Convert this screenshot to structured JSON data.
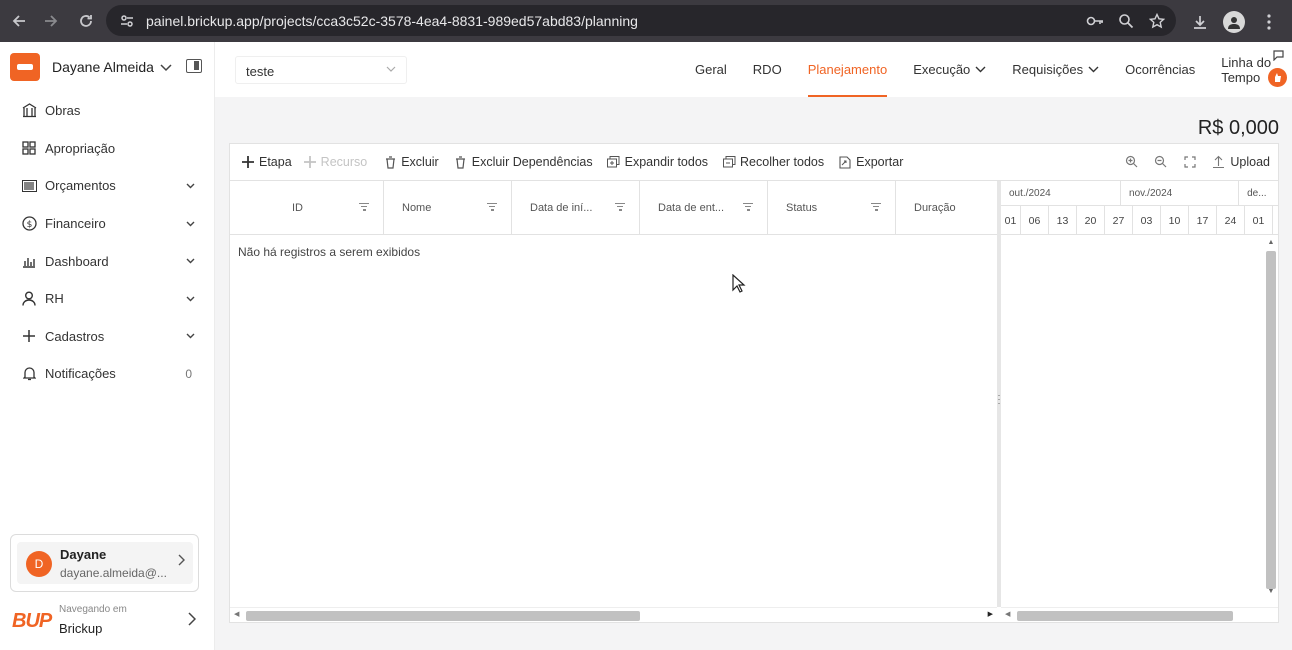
{
  "browser": {
    "url": "painel.brickup.app/projects/cca3c52c-3578-4ea4-8831-989ed57abd83/planning"
  },
  "sidebar": {
    "user_name": "Dayane Almeida",
    "items": [
      {
        "label": "Obras",
        "icon": "building-icon",
        "has_chevron": false
      },
      {
        "label": "Apropriação",
        "icon": "grid-icon",
        "has_chevron": false
      },
      {
        "label": "Orçamentos",
        "icon": "barcode-icon",
        "has_chevron": true
      },
      {
        "label": "Financeiro",
        "icon": "dollar-circle-icon",
        "has_chevron": true
      },
      {
        "label": "Dashboard",
        "icon": "bar-chart-icon",
        "has_chevron": true
      },
      {
        "label": "RH",
        "icon": "person-icon",
        "has_chevron": true
      },
      {
        "label": "Cadastros",
        "icon": "plus-icon",
        "has_chevron": true
      },
      {
        "label": "Notificações",
        "icon": "bell-icon",
        "count": "0"
      }
    ],
    "user_card": {
      "initial": "D",
      "name": "Dayane",
      "email": "dayane.almeida@..."
    },
    "company": {
      "logo_text": "BUP",
      "nav_label": "Navegando em",
      "name": "Brickup"
    }
  },
  "header": {
    "project_select": "teste",
    "tabs": [
      {
        "label": "Geral",
        "active": false,
        "chevron": false
      },
      {
        "label": "RDO",
        "active": false,
        "chevron": false
      },
      {
        "label": "Planejamento",
        "active": true,
        "chevron": false
      },
      {
        "label": "Execução",
        "active": false,
        "chevron": true
      },
      {
        "label": "Requisições",
        "active": false,
        "chevron": true
      },
      {
        "label": "Ocorrências",
        "active": false,
        "chevron": false
      },
      {
        "label": "Linha do Tempo",
        "active": false,
        "chevron": false
      }
    ]
  },
  "content": {
    "total": "R$ 0,000",
    "toolbar": {
      "etapa": "Etapa",
      "recurso": "Recurso",
      "excluir": "Excluir",
      "excluir_dependencias": "Excluir Dependências",
      "expandir_todos": "Expandir todos",
      "recolher_todos": "Recolher todos",
      "exportar": "Exportar",
      "upload": "Upload"
    },
    "columns": [
      "ID",
      "Nome",
      "Data de iní...",
      "Data de ent...",
      "Status",
      "Duração"
    ],
    "empty_message": "Não há registros a serem exibidos",
    "gantt": {
      "months": [
        "out./2024",
        "nov./2024",
        "de..."
      ],
      "days": [
        "01",
        "06",
        "13",
        "20",
        "27",
        "03",
        "10",
        "17",
        "24",
        "01"
      ]
    }
  },
  "colors": {
    "accent": "#f06424",
    "browser_bar": "#3c3a40"
  }
}
